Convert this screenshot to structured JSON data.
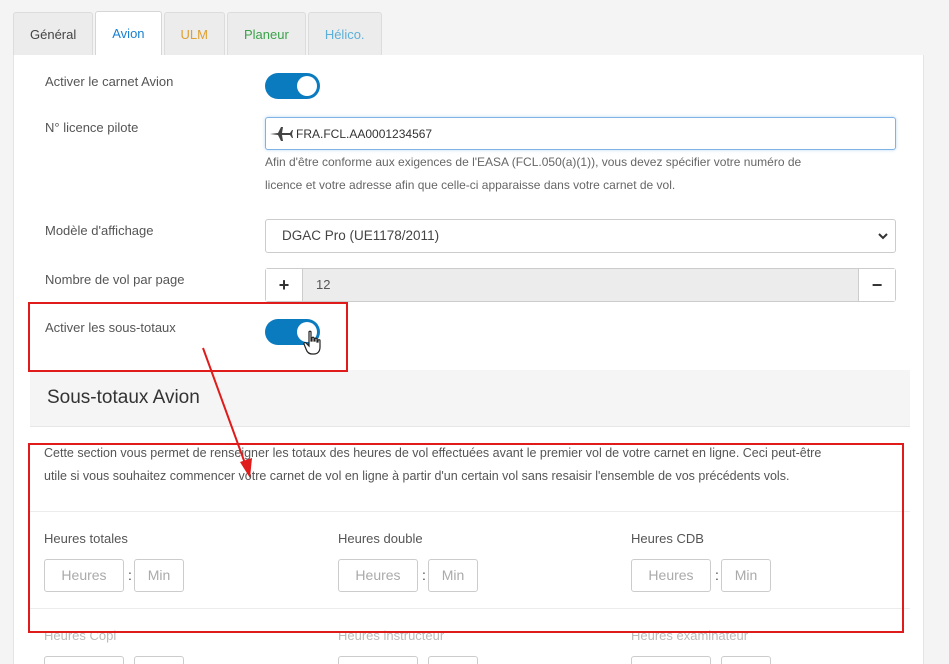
{
  "tabs": [
    {
      "label": "Général",
      "color": "#444444"
    },
    {
      "label": "Avion",
      "color": "#1a7fd0"
    },
    {
      "label": "ULM",
      "color": "#e0a030"
    },
    {
      "label": "Planeur",
      "color": "#3aa24a"
    },
    {
      "label": "Hélico.",
      "color": "#5bb0d8"
    }
  ],
  "settings": {
    "activate_label": "Activer le carnet Avion",
    "licence_label": "N° licence pilote",
    "licence_value": "FRA.FCL.AA0001234567",
    "licence_help_1": "Afin d'être conforme aux exigences de l'EASA (FCL.050(a)(1)), vous devez spécifier votre numéro de",
    "licence_help_2": "licence et votre adresse afin que celle-ci apparaisse dans votre carnet de vol.",
    "model_label": "Modèle d'affichage",
    "model_value": "DGAC Pro (UE1178/2011)",
    "flights_label": "Nombre de vol par page",
    "flights_value": "12",
    "plus": "+",
    "minus": "−",
    "subtotals_label": "Activer les sous-totaux"
  },
  "subtotals": {
    "title": "Sous-totaux Avion",
    "desc_1": "Cette section vous permet de renseigner les totaux des heures de vol effectuées avant le premier vol de votre carnet en ligne. Ceci peut-être",
    "desc_2": "utile si vous souhaitez commencer votre carnet de vol en ligne à partir d'un certain vol sans resaisir l'ensemble de vos précédents vols.",
    "hours_placeholder": "Heures",
    "min_placeholder": "Min",
    "colon": ":",
    "row1": [
      "Heures totales",
      "Heures double",
      "Heures CDB"
    ],
    "row2": [
      "Heures Copi",
      "Heures instructeur",
      "Heures examinateur"
    ]
  },
  "colors": {
    "accent": "#0b7bc0",
    "annotation": "#e01b1b"
  }
}
